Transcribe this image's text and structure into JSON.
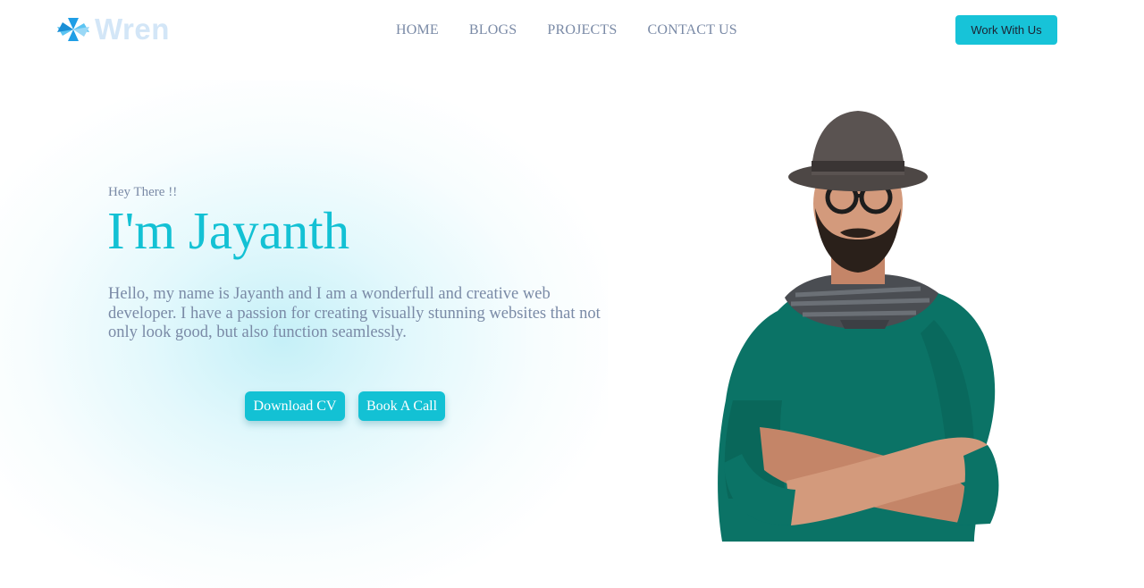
{
  "header": {
    "logo_text": "Wren",
    "nav": [
      "HOME",
      "BLOGS",
      "PROJECTS",
      "CONTACT US"
    ],
    "cta_label": "Work With Us"
  },
  "hero": {
    "greeting": "Hey There !!",
    "title": "I'm Jayanth",
    "intro": "Hello, my name is Jayanth and I am a wonderfull and creative web developer. I have a passion for creating visually stunning websites that not only look good, but also function seamlessly.",
    "buttons": {
      "download": "Download CV",
      "call": "Book A Call"
    }
  },
  "icons": {
    "logo": "snowflake-logo-icon",
    "portrait": "developer-portrait-image"
  },
  "colors": {
    "accent": "#13c1d4",
    "nav_text": "#7a8aa6",
    "logo_text": "#d3e6f7",
    "logo_icon": "#2ea8e8"
  }
}
